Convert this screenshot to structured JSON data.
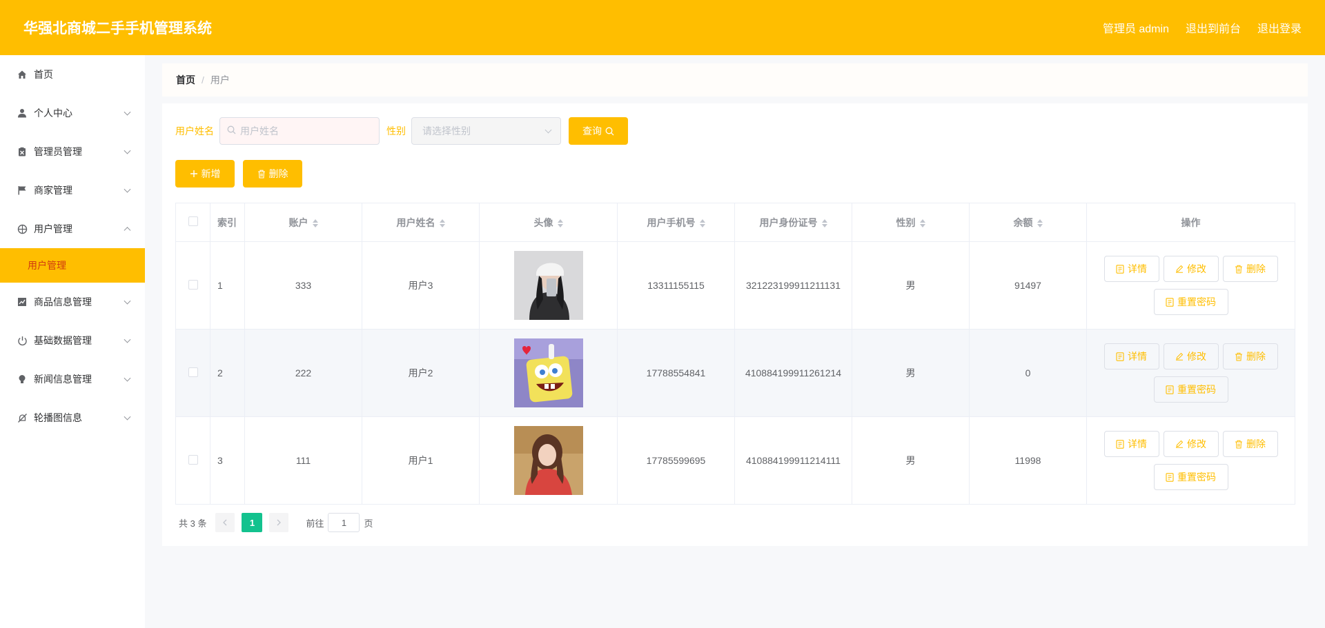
{
  "header": {
    "title": "华强北商城二手手机管理系统",
    "admin_label": "管理员 admin",
    "to_front": "退出到前台",
    "logout": "退出登录"
  },
  "sidebar": {
    "items": [
      {
        "label": "首页",
        "icon": "home-icon"
      },
      {
        "label": "个人中心",
        "icon": "user-icon"
      },
      {
        "label": "管理员管理",
        "icon": "clipboard-icon"
      },
      {
        "label": "商家管理",
        "icon": "flag-icon"
      },
      {
        "label": "用户管理",
        "icon": "globe-icon"
      },
      {
        "label": "用户管理",
        "icon": ""
      },
      {
        "label": "商品信息管理",
        "icon": "chart-icon"
      },
      {
        "label": "基础数据管理",
        "icon": "power-icon"
      },
      {
        "label": "新闻信息管理",
        "icon": "bulb-icon"
      },
      {
        "label": "轮播图信息",
        "icon": "bell-off-icon"
      }
    ]
  },
  "breadcrumb": {
    "home": "首页",
    "sep": "/",
    "current": "用户"
  },
  "search": {
    "name_label": "用户姓名",
    "name_placeholder": "用户姓名",
    "gender_label": "性别",
    "gender_placeholder": "请选择性别",
    "query_button": "查询"
  },
  "actions": {
    "add": "新增",
    "delete": "删除"
  },
  "table": {
    "headers": [
      "索引",
      "账户",
      "用户姓名",
      "头像",
      "用户手机号",
      "用户身份证号",
      "性别",
      "余额",
      "操作"
    ],
    "rows": [
      {
        "index": "1",
        "account": "333",
        "name": "用户3",
        "avatar": "photo-girl-cap",
        "phone": "13311155115",
        "id_card": "321223199911211131",
        "gender": "男",
        "balance": "91497"
      },
      {
        "index": "2",
        "account": "222",
        "name": "用户2",
        "avatar": "photo-spongebob",
        "phone": "17788554841",
        "id_card": "410884199911261214",
        "gender": "男",
        "balance": "0"
      },
      {
        "index": "3",
        "account": "111",
        "name": "用户1",
        "avatar": "photo-girl-red",
        "phone": "17785599695",
        "id_card": "410884199911214111",
        "gender": "男",
        "balance": "11998"
      }
    ],
    "op_labels": {
      "detail": "详情",
      "edit": "修改",
      "delete": "删除",
      "reset": "重置密码"
    }
  },
  "pager": {
    "total": "共 3 条",
    "current_page": "1",
    "goto_label": "前往",
    "goto_value": "1",
    "page_suffix": "页"
  },
  "colors": {
    "accent": "#ffbe00",
    "page_active": "#13c28e",
    "sub_active_text": "#d03b0f"
  }
}
